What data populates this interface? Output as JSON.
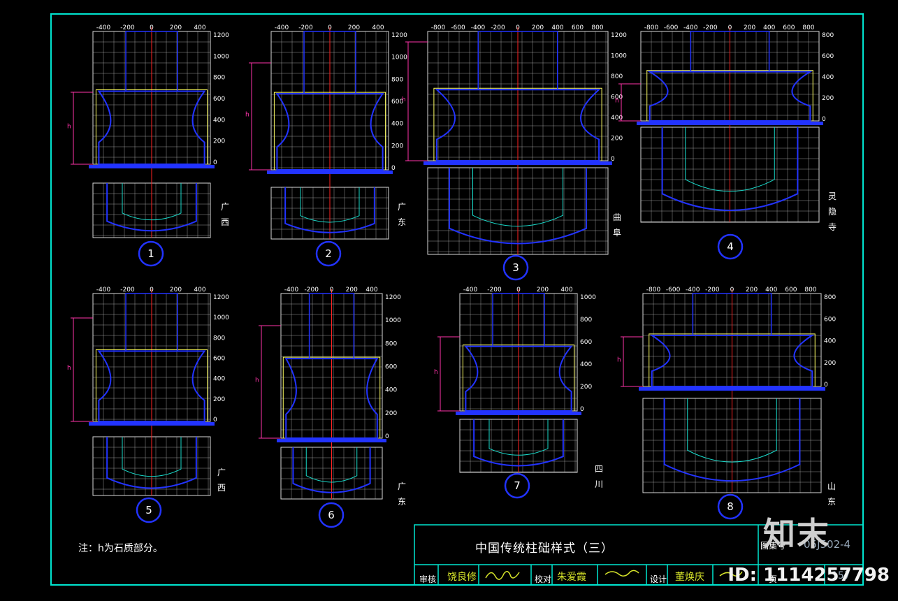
{
  "title": "中国传统柱础样式（三）",
  "note": "注：h为石质部分。",
  "code_label": "图集号",
  "code": "05J502-4",
  "page_label": "页",
  "page": "157",
  "roles": [
    {
      "label": "审核",
      "name": "饶良修"
    },
    {
      "label": "校对",
      "name": "朱爱霞"
    },
    {
      "label": "设计",
      "name": "董焕庆"
    }
  ],
  "watermark_id": "ID: 1114257798",
  "logo": "知末",
  "h_label": "h",
  "colors": {
    "frame": "#00e5d0",
    "grid": "#d8d8d8",
    "ruler": "#2233ff",
    "stone": "#ffff66",
    "dim": "#ff33aa",
    "axis": "#ff2222",
    "name": "#d7e52a"
  },
  "panels": [
    {
      "num": "1",
      "region": "广西",
      "ticks_x": [
        "-400",
        "-200",
        "0",
        "200",
        "400"
      ],
      "ticks_y": [
        "1200",
        "1000",
        "800",
        "600",
        "400",
        "200",
        "0"
      ]
    },
    {
      "num": "2",
      "region": "广东",
      "ticks_x": [
        "-400",
        "-200",
        "0",
        "200",
        "400"
      ],
      "ticks_y": [
        "1200",
        "1000",
        "800",
        "600",
        "400",
        "200",
        "0"
      ]
    },
    {
      "num": "3",
      "region": "曲阜",
      "ticks_x": [
        "-800",
        "-600",
        "-400",
        "-200",
        "0",
        "200",
        "400",
        "600",
        "800"
      ],
      "ticks_y": [
        "1200",
        "1000",
        "800",
        "600",
        "400",
        "200",
        "0"
      ]
    },
    {
      "num": "4",
      "region": "灵隐寺",
      "ticks_x": [
        "-800",
        "-600",
        "-400",
        "-200",
        "0",
        "200",
        "400",
        "600",
        "800"
      ],
      "ticks_y": [
        "800",
        "600",
        "400",
        "200",
        "0"
      ]
    },
    {
      "num": "5",
      "region": "广西",
      "ticks_x": [
        "-400",
        "-200",
        "0",
        "200",
        "400"
      ],
      "ticks_y": [
        "1200",
        "1000",
        "800",
        "600",
        "400",
        "200",
        "0"
      ]
    },
    {
      "num": "6",
      "region": "广东",
      "ticks_x": [
        "-400",
        "-200",
        "0",
        "200",
        "400"
      ],
      "ticks_y": [
        "1200",
        "1000",
        "800",
        "600",
        "400",
        "200",
        "0"
      ]
    },
    {
      "num": "7",
      "region": "四川",
      "ticks_x": [
        "-400",
        "-200",
        "0",
        "200",
        "400"
      ],
      "ticks_y": [
        "1000",
        "800",
        "600",
        "400",
        "200",
        "0"
      ]
    },
    {
      "num": "8",
      "region": "山东",
      "ticks_x": [
        "-800",
        "-600",
        "-400",
        "-200",
        "0",
        "200",
        "400",
        "600",
        "800"
      ],
      "ticks_y": [
        "800",
        "600",
        "400",
        "200",
        "0"
      ]
    }
  ]
}
